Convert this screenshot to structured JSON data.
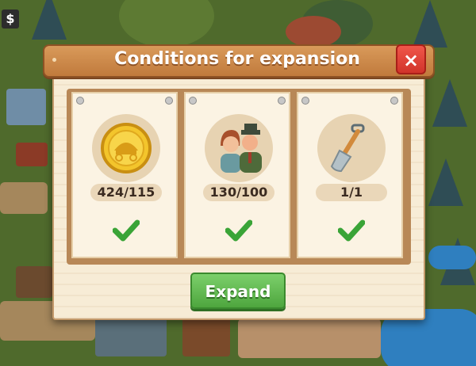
{
  "hud": {
    "currency_symbol": "$"
  },
  "dialog": {
    "title": "Conditions for expansion",
    "close_label": "×",
    "conditions": [
      {
        "icon": "gold-wagon-coin-icon",
        "value": "424/115",
        "met": true
      },
      {
        "icon": "settlers-couple-icon",
        "value": "130/100",
        "met": true
      },
      {
        "icon": "shovel-icon",
        "value": "1/1",
        "met": true
      }
    ],
    "expand_label": "Expand"
  },
  "colors": {
    "title_wood": "#c88446",
    "close_red": "#d9382e",
    "check_green": "#3aa437",
    "expand_green": "#5cb84a",
    "parchment": "#f7ecd6"
  }
}
